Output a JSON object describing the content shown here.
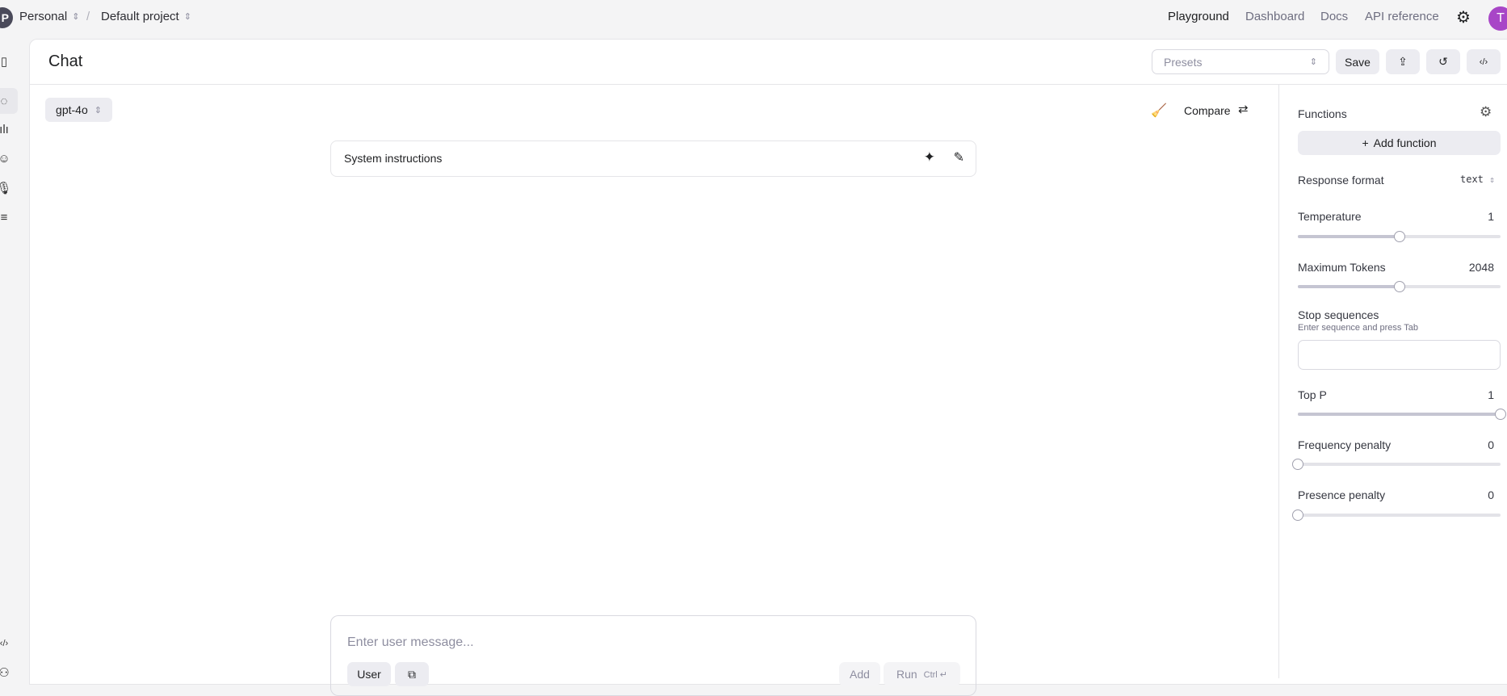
{
  "topbar": {
    "org_initial": "P",
    "org": "Personal",
    "project": "Default project",
    "nav": [
      "Playground",
      "Dashboard",
      "Docs",
      "API reference"
    ],
    "user_initial": "T"
  },
  "header": {
    "title": "Chat",
    "presets_placeholder": "Presets",
    "save": "Save"
  },
  "chat": {
    "model": "gpt-4o",
    "compare": "Compare",
    "system_instructions": "System instructions",
    "message_placeholder": "Enter user message...",
    "role": "User",
    "add": "Add",
    "run": "Run",
    "run_shortcut": "Ctrl ↵"
  },
  "panel": {
    "functions": "Functions",
    "add_function": "Add function",
    "response_format_label": "Response format",
    "response_format": "text",
    "temperature": {
      "label": "Temperature",
      "value": "1",
      "fraction": 0.5
    },
    "max_tokens": {
      "label": "Maximum Tokens",
      "value": "2048",
      "fraction": 0.5
    },
    "stop": {
      "label": "Stop sequences",
      "hint": "Enter sequence and press Tab"
    },
    "top_p": {
      "label": "Top P",
      "value": "1",
      "fraction": 1
    },
    "frequency": {
      "label": "Frequency penalty",
      "value": "0",
      "fraction": 0
    },
    "presence": {
      "label": "Presence penalty",
      "value": "0",
      "fraction": 0
    }
  },
  "colors": {
    "accent_avatar": "#a846c7",
    "button_bg": "#ececf1"
  }
}
